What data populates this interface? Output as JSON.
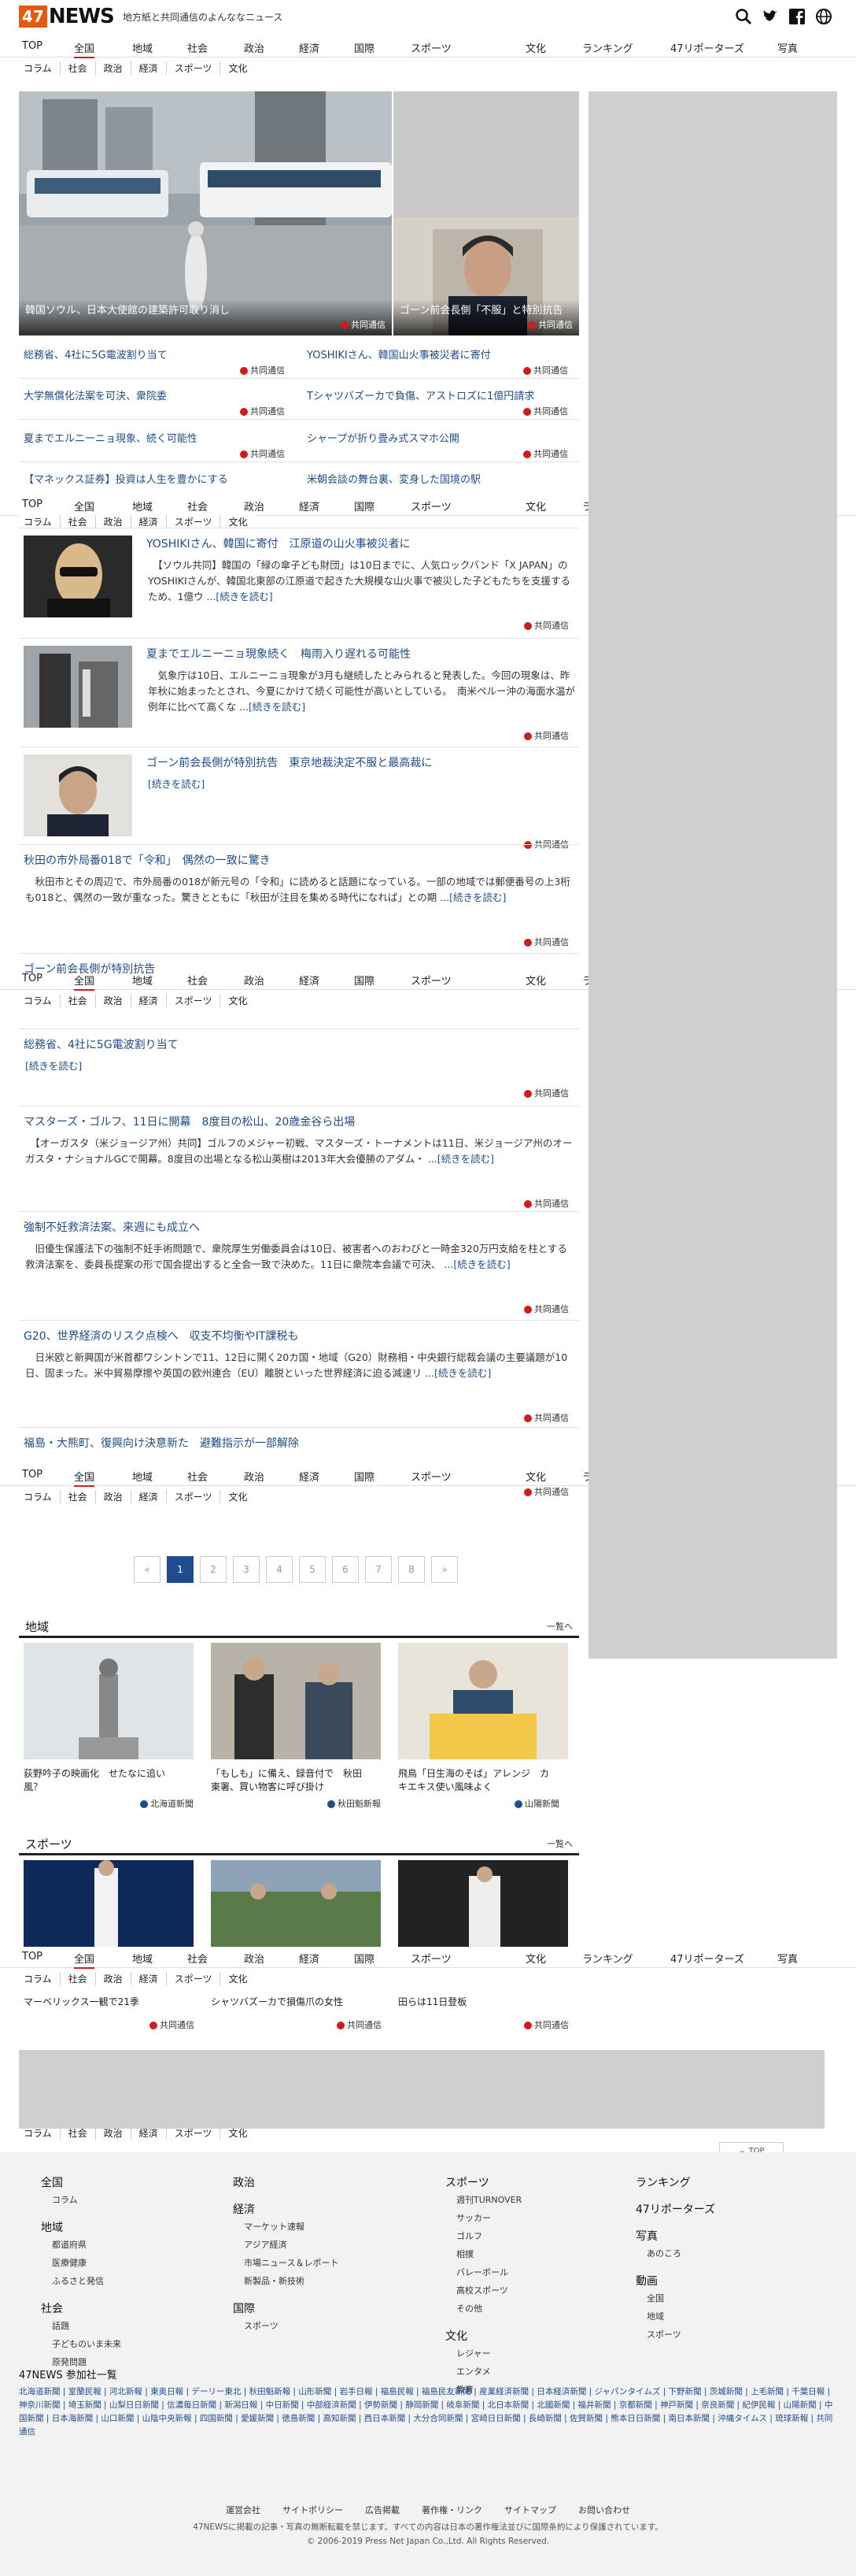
{
  "header": {
    "logo_num": "47",
    "logo_word": "NEWS",
    "tagline": "地方紙と共同通信のよんななニュース",
    "icons": [
      "search-icon",
      "twitter-icon",
      "facebook-icon",
      "globe-icon"
    ]
  },
  "nav": {
    "items": [
      "TOP",
      "全国",
      "地域",
      "社会",
      "政治",
      "経済",
      "国際",
      "スポーツ",
      "文化",
      "ランキング",
      "47リポーターズ",
      "写真"
    ],
    "active": "全国"
  },
  "subnav": {
    "full": [
      "コラム",
      "社会",
      "政治",
      "経済",
      "スポーツ",
      "文化"
    ],
    "short": [
      "コラム",
      "社会",
      "政治",
      "経済",
      "スポーツ",
      "文化"
    ]
  },
  "hero": {
    "main_caption": "韓国ソウル、日本大使館の建築許可取り消し",
    "main_source": "共同通信",
    "side_caption": "ゴーン前会長側「不服」と特別抗告",
    "side_source": "共同通信"
  },
  "headlines": [
    {
      "title": "総務省、4社に5G電波割り当て",
      "source": "共同通信"
    },
    {
      "title": "YOSHIKIさん、韓国山火事被災者に寄付",
      "source": "共同通信"
    },
    {
      "title": "大学無償化法案を可決、衆院委",
      "source": "共同通信"
    },
    {
      "title": "Tシャツバズーカで負傷、アストロズに1億円請求",
      "source": "共同通信"
    },
    {
      "title": "夏までエルニーニョ現象、続く可能性",
      "source": "共同通信"
    },
    {
      "title": "シャープが折り畳み式スマホ公開",
      "source": "共同通信"
    },
    {
      "title": "【マネックス証券】投資は人生を豊かにする",
      "source": ""
    },
    {
      "title": "米朝会談の舞台裏、変身した国境の駅",
      "source": ""
    }
  ],
  "articles": [
    {
      "title": "YOSHIKIさん、韓国に寄付　江原道の山火事被災者に",
      "body": "　【ソウル共同】韓国の「緑の傘子ども財団」は10日までに、人気ロックバンド「X JAPAN」のYOSHIKIさんが、韓国北東部の江原道で起きた大規模な山火事で被災した子どもたちを支援するため、1億ウ ...",
      "more": "[続きを読む]",
      "source": "共同通信"
    },
    {
      "title": "夏までエルニーニョ現象続く　梅雨入り遅れる可能性",
      "body": "　気象庁は10日、エルニーニョ現象が3月も継続したとみられると発表した。今回の現象は、昨年秋に始まったとされ、今夏にかけて続く可能性が高いとしている。　南米ペルー沖の海面水温が例年に比べて高くな ...",
      "more": "[続きを読む]",
      "source": "共同通信"
    },
    {
      "title": "ゴーン前会長側が特別抗告　東京地裁決定不服と最高裁に",
      "body": "",
      "more": "[続きを読む]",
      "source": "共同通信"
    },
    {
      "title": "秋田の市外局番018で「令和」　偶然の一致に驚き",
      "body": "　秋田市とその周辺で、市外局番の018が新元号の「令和」に読めると話題になっている。一部の地域では郵便番号の上3桁も018と、偶然の一致が重なった。驚きとともに「秋田が注目を集める時代になれば」との期 ...",
      "more": "[続きを読む]",
      "source": "共同通信"
    },
    {
      "title": "ゴーン前会長側が特別抗告",
      "body": "",
      "more": "",
      "source": ""
    },
    {
      "title": "総務省、4社に5G電波割り当て",
      "body": "",
      "more": "[続きを読む]",
      "source": "共同通信"
    },
    {
      "title": "マスターズ・ゴルフ、11日に開幕　8度目の松山、20歳金谷ら出場",
      "body": "　【オーガスタ（米ジョージア州）共同】ゴルフのメジャー初戦、マスターズ・トーナメントは11日、米ジョージア州のオーガスタ・ナショナルGCで開幕。8度目の出場となる松山英樹は2013年大会優勝のアダム・ ...",
      "more": "[続きを読む]",
      "source": "共同通信"
    },
    {
      "title": "強制不妊救済法案、来週にも成立へ",
      "body": "　旧優生保護法下の強制不妊手術問題で、衆院厚生労働委員会は10日、被害者へのおわびと一時金320万円支給を柱とする救済法案を、委員長提案の形で国会提出すると全会一致で決めた。11日に衆院本会議で可決、 ...",
      "more": "[続きを読む]",
      "source": "共同通信"
    },
    {
      "title": "G20、世界経済のリスク点検へ　収支不均衡やIT課税も",
      "body": "　日米欧と新興国が米首都ワシントンで11、12日に開く20カ国・地域（G20）財務相・中央銀行総裁会議の主要議題が10日、固まった。米中貿易摩擦や英国の欧州連合（EU）離脱といった世界経済に迫る減速リ ...",
      "more": "[続きを読む]",
      "source": "共同通信"
    },
    {
      "title": "福島・大熊町、復興向け決意新た　避難指示が一部解除",
      "body": "",
      "more": "",
      "source": "共同通信"
    }
  ],
  "pager": {
    "prev": "«",
    "pages": [
      "1",
      "2",
      "3",
      "4",
      "5",
      "6",
      "7",
      "8"
    ],
    "next": "»",
    "active": "1"
  },
  "region": {
    "title": "地域",
    "more": "一覧へ",
    "cards": [
      {
        "title": "荻野吟子の映画化　せたなに追い風？",
        "source": "北海道新聞"
      },
      {
        "title": "「もしも」に備え、録音付で　秋田東署、買い物客に呼び掛け",
        "source": "秋田魁新報"
      },
      {
        "title": "飛鳥「日生海のそば」アレンジ　カキエキス使い風味よく",
        "source": "山陽新聞"
      }
    ]
  },
  "sports": {
    "title": "スポーツ",
    "more": "一覧へ",
    "cards": [
      {
        "title": "マーベリックス一観で21季",
        "source": "共同通信"
      },
      {
        "title": "シャツバズーカで損傷爪の女性",
        "source": "共同通信"
      },
      {
        "title": "田らは11日登板",
        "source": "共同通信"
      }
    ]
  },
  "totop": "TOP",
  "footer": {
    "columns": [
      {
        "head": "全国",
        "items": [
          "コラム"
        ]
      },
      {
        "head": "地域",
        "items": [
          "都道府県",
          "医療健康",
          "ふるさと発信"
        ]
      },
      {
        "head": "社会",
        "items": [
          "話題",
          "子どものいま未来",
          "原発問題"
        ]
      },
      {
        "head": "政治",
        "items": []
      },
      {
        "head": "経済",
        "items": [
          "マーケット速報",
          "アジア経済",
          "市場ニュース＆レポート",
          "新製品・新技術"
        ]
      },
      {
        "head": "国際",
        "items": [
          "スポーツ"
        ]
      },
      {
        "head": "スポーツ",
        "items": [
          "週刊TURNOVER",
          "サッカー",
          "ゴルフ",
          "相撲",
          "バレーボール",
          "高校スポーツ",
          "その他"
        ]
      },
      {
        "head": "文化",
        "items": [
          "レジャー",
          "エンタメ",
          "教育"
        ]
      },
      {
        "head": "ランキング",
        "items": []
      },
      {
        "head": "47リポーターズ",
        "items": []
      },
      {
        "head": "写真",
        "items": [
          "あのころ"
        ]
      },
      {
        "head": "動画",
        "items": [
          "全国",
          "地域",
          "スポーツ"
        ]
      }
    ],
    "members_title": "47NEWS 参加社一覧",
    "members": "北海道新聞 | 室蘭民報 | 河北新報 | 東奥日報 | デーリー東北 | 秋田魁新報 | 山形新聞 | 岩手日報 | 福島民報 | 福島民友新聞 | 産業経済新聞 | 日本経済新聞 | ジャパンタイムズ | 下野新聞 | 茨城新聞 | 上毛新聞 | 千葉日報 | 神奈川新聞 | 埼玉新聞 | 山梨日日新聞 | 信濃毎日新聞 | 新潟日報 | 中日新聞 | 中部経済新聞 | 伊勢新聞 | 静岡新聞 | 岐阜新聞 | 北日本新聞 | 北國新聞 | 福井新聞 | 京都新聞 | 神戸新聞 | 奈良新聞 | 紀伊民報 | 山陽新聞 | 中国新聞 | 日本海新聞 | 山口新聞 | 山陰中央新報 | 四国新聞 | 愛媛新聞 | 徳島新聞 | 高知新聞 | 西日本新聞 | 大分合同新聞 | 宮崎日日新聞 | 長崎新聞 | 佐賀新聞 | 熊本日日新聞 | 南日本新聞 | 沖縄タイムス | 琉球新報 | 共同通信",
    "links": [
      "運営会社",
      "サイトポリシー",
      "広告掲載",
      "著作権・リンク",
      "サイトマップ",
      "お問い合わせ"
    ],
    "notice": "47NEWSに掲載の記事・写真の無断転載を禁じます。すべての内容は日本の著作権法並びに国際条約により保護されています。",
    "copyright": "© 2006-2019 Press Net Japan Co.,Ltd. All Rights Reserved."
  }
}
